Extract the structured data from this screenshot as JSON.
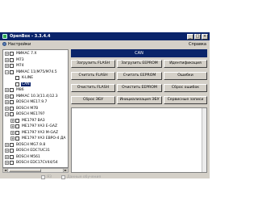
{
  "window": {
    "title": "OpenBox - 3.3.4.4",
    "min": "_",
    "max": "□",
    "close": "×"
  },
  "menu": {
    "settings": "Настройки",
    "help": "Справка"
  },
  "tree": [
    {
      "label": "MИКАС 7.X",
      "exp": "+",
      "level": 0
    },
    {
      "label": "M73",
      "exp": "+",
      "level": 0
    },
    {
      "label": "M74",
      "exp": "+",
      "level": 0
    },
    {
      "label": "MИКАС 11(M75/M74.5",
      "exp": "−",
      "level": 0
    },
    {
      "label": "K-LINE",
      "exp": "",
      "level": 1
    },
    {
      "label": "CAN",
      "exp": "",
      "level": 1,
      "selected": true
    },
    {
      "label": "M86",
      "exp": "+",
      "level": 0
    },
    {
      "label": "MИКАС 10.3(11.4)12.3",
      "exp": "+",
      "level": 0
    },
    {
      "label": "BOSCH ME17.9.7",
      "exp": "+",
      "level": 0
    },
    {
      "label": "BOSCH M7B",
      "exp": "+",
      "level": 0
    },
    {
      "label": "BOSCH ME1797",
      "exp": "−",
      "level": 0
    },
    {
      "label": "ME1797 BA3",
      "exp": "+",
      "level": 1
    },
    {
      "label": "ME1797 УАЗ E-GAZ",
      "exp": "+",
      "level": 1
    },
    {
      "label": "ME1797 УАЗ M-GAZ",
      "exp": "+",
      "level": 1
    },
    {
      "label": "ME1797 УАЗ ЕВРО-4 ДА",
      "exp": "+",
      "level": 1
    },
    {
      "label": "BOSCH MG7.9.8",
      "exp": "+",
      "level": 0
    },
    {
      "label": "BOSCH EDC7UC31",
      "exp": "+",
      "level": 0
    },
    {
      "label": "BOSCH M561",
      "exp": "+",
      "level": 0
    },
    {
      "label": "BOSCH EDC17CV44/54",
      "exp": "+",
      "level": 0
    }
  ],
  "header": {
    "protocol": "CAN"
  },
  "buttons": {
    "load_flash": "Загрузить FLASH",
    "load_eeprom": "Загрузить EEPROM",
    "identification": "Идентификация",
    "read_flash": "Считать FLASH",
    "read_eeprom": "Считать EEPROM",
    "errors": "Ошибки",
    "erase_flash": "Очистить FLASH",
    "erase_eeprom": "Очистить EEPROM",
    "reset_errors": "Сброс ошибок",
    "reset_ecu": "Сброс ЭБУ",
    "init_ecu": "Инициализация ЭБУ",
    "service_records": "Сервисные записи"
  },
  "scroll": {
    "left": "◄",
    "right": "►"
  },
  "options": {
    "option1": "ЯЗ",
    "option2": "Данные обучения"
  }
}
